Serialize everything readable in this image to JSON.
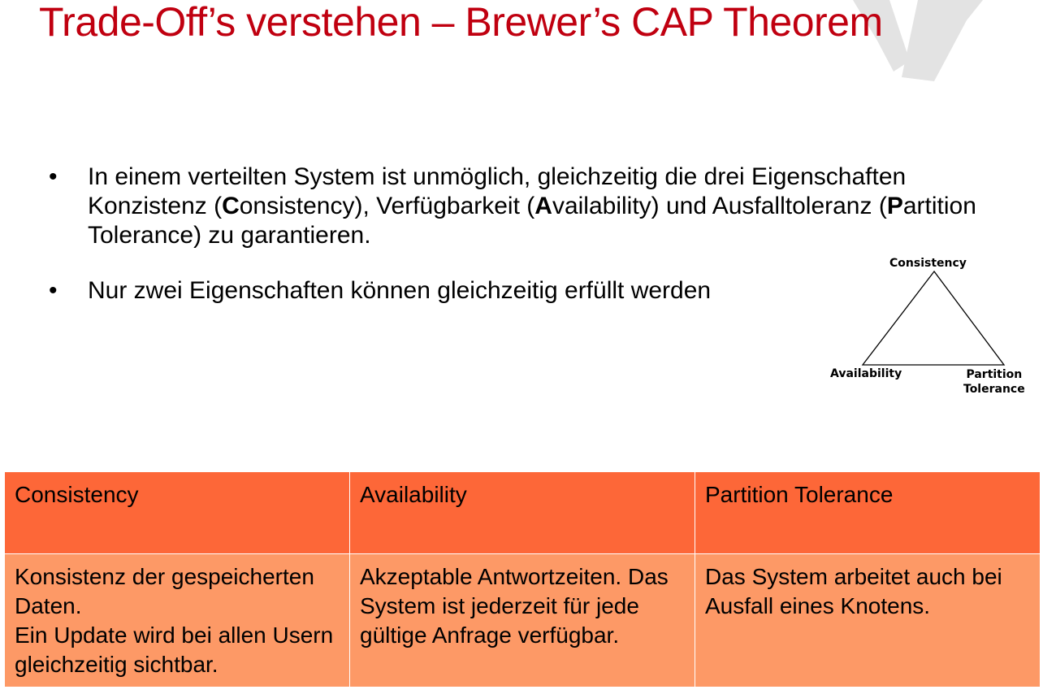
{
  "title": "Trade-Off’s verstehen – Brewer’s CAP Theorem",
  "bullets": [
    {
      "parts": [
        {
          "text": "In einem verteilten System ist unmöglich, gleichzeitig die drei Eigenschaften Konzistenz (",
          "bold": false
        },
        {
          "text": "C",
          "bold": true
        },
        {
          "text": "onsistency), Verfügbarkeit (",
          "bold": false
        },
        {
          "text": "A",
          "bold": true
        },
        {
          "text": "vailability) und Ausfalltoleranz (",
          "bold": false
        },
        {
          "text": "P",
          "bold": true
        },
        {
          "text": "artition Tolerance) zu garantieren.",
          "bold": false
        }
      ]
    },
    {
      "parts": [
        {
          "text": "Nur zwei Eigenschaften können gleichzeitig erfüllt werden",
          "bold": false
        }
      ]
    }
  ],
  "bullet_symbol": "•",
  "cap_triangle": {
    "top_label": "Consistency",
    "left_label": "Availability",
    "right_label": "Partition\nTolerance"
  },
  "table": {
    "headers": [
      "Consistency",
      "Availability",
      "Partition Tolerance"
    ],
    "rows": [
      [
        "Konsistenz der gespeicherten Daten.\nEin Update wird bei allen Usern gleichzeitig sichtbar.",
        "Akzeptable Antwortzeiten. Das System ist jederzeit für jede gültige Anfrage verfügbar.",
        "Das System arbeitet auch bei Ausfall eines Knotens."
      ]
    ]
  },
  "colors": {
    "title": "#c00010",
    "header_bg": "#fd6738",
    "body_bg": "#fd9966",
    "logo_gray": "#e3e3e3"
  },
  "icons": [
    "logo-mark"
  ]
}
